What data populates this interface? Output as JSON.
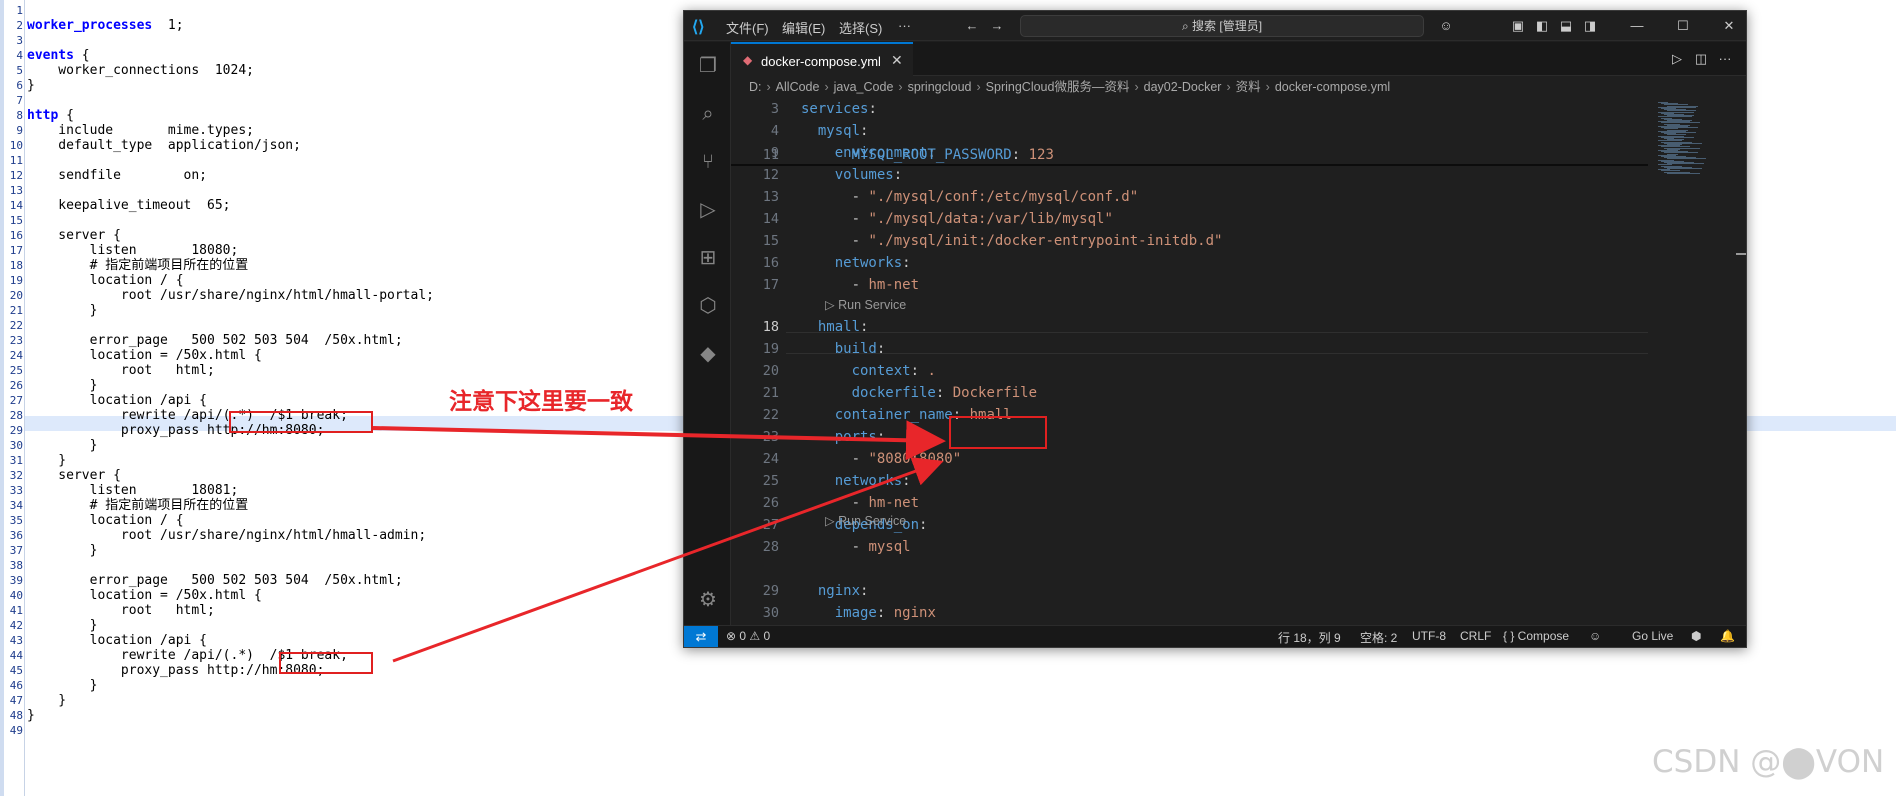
{
  "nginx_conf": {
    "lines": [
      {
        "n": "1",
        "t": ""
      },
      {
        "n": "2",
        "t": "worker_processes  1;"
      },
      {
        "n": "3",
        "t": ""
      },
      {
        "n": "4",
        "t": "events {"
      },
      {
        "n": "5",
        "t": "    worker_connections  1024;"
      },
      {
        "n": "6",
        "t": "}"
      },
      {
        "n": "7",
        "t": ""
      },
      {
        "n": "8",
        "t": "http {"
      },
      {
        "n": "9",
        "t": "    include       mime.types;"
      },
      {
        "n": "10",
        "t": "    default_type  application/json;"
      },
      {
        "n": "11",
        "t": ""
      },
      {
        "n": "12",
        "t": "    sendfile        on;"
      },
      {
        "n": "13",
        "t": ""
      },
      {
        "n": "14",
        "t": "    keepalive_timeout  65;"
      },
      {
        "n": "15",
        "t": ""
      },
      {
        "n": "16",
        "t": "    server {"
      },
      {
        "n": "17",
        "t": "        listen       18080;"
      },
      {
        "n": "18",
        "t": "        # 指定前端项目所在的位置"
      },
      {
        "n": "19",
        "t": "        location / {"
      },
      {
        "n": "20",
        "t": "            root /usr/share/nginx/html/hmall-portal;"
      },
      {
        "n": "21",
        "t": "        }"
      },
      {
        "n": "22",
        "t": ""
      },
      {
        "n": "23",
        "t": "        error_page   500 502 503 504  /50x.html;"
      },
      {
        "n": "24",
        "t": "        location = /50x.html {"
      },
      {
        "n": "25",
        "t": "            root   html;"
      },
      {
        "n": "26",
        "t": "        }"
      },
      {
        "n": "27",
        "t": "        location /api {"
      },
      {
        "n": "28",
        "t": "            rewrite /api/(.*)  /$1 break;"
      },
      {
        "n": "29",
        "t": "            proxy_pass http://hm:8080;"
      },
      {
        "n": "30",
        "t": "        }"
      },
      {
        "n": "31",
        "t": "    }"
      },
      {
        "n": "32",
        "t": "    server {"
      },
      {
        "n": "33",
        "t": "        listen       18081;"
      },
      {
        "n": "34",
        "t": "        # 指定前端项目所在的位置"
      },
      {
        "n": "35",
        "t": "        location / {"
      },
      {
        "n": "36",
        "t": "            root /usr/share/nginx/html/hmall-admin;"
      },
      {
        "n": "37",
        "t": "        }"
      },
      {
        "n": "38",
        "t": ""
      },
      {
        "n": "39",
        "t": "        error_page   500 502 503 504  /50x.html;"
      },
      {
        "n": "40",
        "t": "        location = /50x.html {"
      },
      {
        "n": "41",
        "t": "            root   html;"
      },
      {
        "n": "42",
        "t": "        }"
      },
      {
        "n": "43",
        "t": "        location /api {"
      },
      {
        "n": "44",
        "t": "            rewrite /api/(.*)  /$1 break;"
      },
      {
        "n": "45",
        "t": "            proxy_pass http://hm:8080;"
      },
      {
        "n": "46",
        "t": "        }"
      },
      {
        "n": "47",
        "t": "    }"
      },
      {
        "n": "48",
        "t": "}"
      },
      {
        "n": "49",
        "t": ""
      }
    ]
  },
  "annotation": {
    "text": "注意下这里要一致",
    "color": "#e8262a"
  },
  "vscode": {
    "menu": [
      "文件(F)",
      "编辑(E)",
      "选择(S)",
      "···"
    ],
    "search_placeholder": "⌕ 搜索 [管理员]",
    "tab": {
      "label": "docker-compose.yml",
      "close": "✕"
    },
    "breadcrumb": [
      "D:",
      "AllCode",
      "java_Code",
      "springcloud",
      "SpringCloud微服务—资料",
      "day02-Docker",
      "资料",
      "docker-compose.yml"
    ],
    "code": [
      {
        "n": "3",
        "parts": [
          [
            "k",
            "services"
          ],
          [
            "p",
            ":"
          ]
        ]
      },
      {
        "n": "4",
        "parts": [
          [
            "p",
            "  "
          ],
          [
            "k",
            "mysql"
          ],
          [
            "p",
            ":"
          ]
        ]
      },
      {
        "n": "9",
        "parts": [
          [
            "p",
            "    "
          ],
          [
            "k",
            "environment"
          ],
          [
            "p",
            ":"
          ]
        ]
      },
      {
        "n": "11",
        "parts": [
          [
            "p",
            "      "
          ],
          [
            "k",
            "MYSQL_ROOT_PASSWORD"
          ],
          [
            "p",
            ": "
          ],
          [
            "s",
            "123"
          ]
        ]
      },
      {
        "n": "12",
        "parts": [
          [
            "p",
            "    "
          ],
          [
            "k",
            "volumes"
          ],
          [
            "p",
            ":"
          ]
        ]
      },
      {
        "n": "13",
        "parts": [
          [
            "p",
            "      - "
          ],
          [
            "s",
            "\"./mysql/conf:/etc/mysql/conf.d\""
          ]
        ]
      },
      {
        "n": "14",
        "parts": [
          [
            "p",
            "      - "
          ],
          [
            "s",
            "\"./mysql/data:/var/lib/mysql\""
          ]
        ]
      },
      {
        "n": "15",
        "parts": [
          [
            "p",
            "      - "
          ],
          [
            "s",
            "\"./mysql/init:/docker-entrypoint-initdb.d\""
          ]
        ]
      },
      {
        "n": "16",
        "parts": [
          [
            "p",
            "    "
          ],
          [
            "k",
            "networks"
          ],
          [
            "p",
            ":"
          ]
        ]
      },
      {
        "n": "17",
        "parts": [
          [
            "p",
            "      - "
          ],
          [
            "s",
            "hm-net"
          ]
        ]
      },
      {
        "n": "18",
        "parts": [
          [
            "p",
            "  "
          ],
          [
            "k",
            "hmall"
          ],
          [
            "p",
            ":"
          ]
        ]
      },
      {
        "n": "19",
        "parts": [
          [
            "p",
            "    "
          ],
          [
            "k",
            "build"
          ],
          [
            "p",
            ":"
          ]
        ]
      },
      {
        "n": "20",
        "parts": [
          [
            "p",
            "      "
          ],
          [
            "k",
            "context"
          ],
          [
            "p",
            ": "
          ],
          [
            "s",
            "."
          ]
        ]
      },
      {
        "n": "21",
        "parts": [
          [
            "p",
            "      "
          ],
          [
            "k",
            "dockerfile"
          ],
          [
            "p",
            ": "
          ],
          [
            "s",
            "Dockerfile"
          ]
        ]
      },
      {
        "n": "22",
        "parts": [
          [
            "p",
            "    "
          ],
          [
            "k",
            "container_name"
          ],
          [
            "p",
            ": "
          ],
          [
            "s",
            "hmall"
          ]
        ]
      },
      {
        "n": "23",
        "parts": [
          [
            "p",
            "    "
          ],
          [
            "k",
            "ports"
          ],
          [
            "p",
            ":"
          ]
        ]
      },
      {
        "n": "24",
        "parts": [
          [
            "p",
            "      - "
          ],
          [
            "s",
            "\"8080:8080\""
          ]
        ]
      },
      {
        "n": "25",
        "parts": [
          [
            "p",
            "    "
          ],
          [
            "k",
            "networks"
          ],
          [
            "p",
            ":"
          ]
        ]
      },
      {
        "n": "26",
        "parts": [
          [
            "p",
            "      - "
          ],
          [
            "s",
            "hm-net"
          ]
        ]
      },
      {
        "n": "27",
        "parts": [
          [
            "p",
            "    "
          ],
          [
            "k",
            "depends_on"
          ],
          [
            "p",
            ":"
          ]
        ]
      },
      {
        "n": "28",
        "parts": [
          [
            "p",
            "      - "
          ],
          [
            "s",
            "mysql"
          ]
        ]
      },
      {
        "n": "29",
        "parts": [
          [
            "p",
            "  "
          ],
          [
            "k",
            "nginx"
          ],
          [
            "p",
            ":"
          ]
        ]
      },
      {
        "n": "30",
        "parts": [
          [
            "p",
            "    "
          ],
          [
            "k",
            "image"
          ],
          [
            "p",
            ": "
          ],
          [
            "s",
            "nginx"
          ]
        ]
      }
    ],
    "codelens": "Run Service",
    "status": {
      "problems": "⊗ 0 ⚠ 0",
      "position": "行 18，列 9",
      "spaces": "空格: 2",
      "encoding": "UTF-8",
      "eol": "CRLF",
      "language": "{ } Compose",
      "golive": "Go Live"
    }
  },
  "watermark": "CSDN @⬤VON",
  "colors": {
    "accent": "#0078d4",
    "annotation_red": "#e02020",
    "yaml_key": "#569cd6",
    "yaml_string": "#ce9178"
  }
}
